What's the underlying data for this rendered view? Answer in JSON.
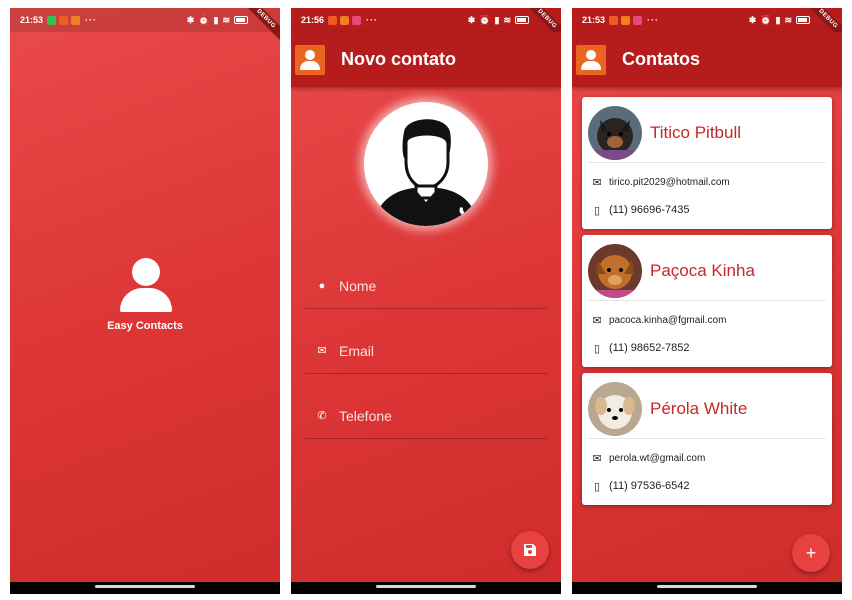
{
  "status_bars": [
    {
      "time": "21:53",
      "apps": [
        "#3bbf4f",
        "#f05b22",
        "#f0801e"
      ]
    },
    {
      "time": "21:56",
      "apps": [
        "#f05b22",
        "#f0801e",
        "#e24b7a"
      ]
    },
    {
      "time": "21:53",
      "apps": [
        "#f05b22",
        "#f0801e",
        "#e24b7a"
      ]
    }
  ],
  "debug_banner": "DEBUG",
  "splash": {
    "title": "Easy Contacts"
  },
  "new_contact": {
    "title": "Novo contato",
    "fields": {
      "name_placeholder": "Nome",
      "email_placeholder": "Email",
      "phone_placeholder": "Telefone"
    }
  },
  "contacts": {
    "title": "Contatos",
    "items": [
      {
        "name": "Titico Pitbull",
        "email": "tirico.pit2029@hotmail.com",
        "phone": "(11) 96696-7435"
      },
      {
        "name": "Paçoca Kinha",
        "email": "pacoca.kinha@fgmail.com",
        "phone": "(11) 98652-7852"
      },
      {
        "name": "Pérola White",
        "email": "perola.wt@gmail.com",
        "phone": "(11) 97536-6542"
      }
    ]
  },
  "fab_icons": {
    "save": "save-icon",
    "add": "add-icon"
  },
  "colors": {
    "primary": "#b71c1c",
    "background": "#dc3535",
    "accent": "#e94040",
    "logo": "#e8661f",
    "name_text": "#c62828"
  }
}
